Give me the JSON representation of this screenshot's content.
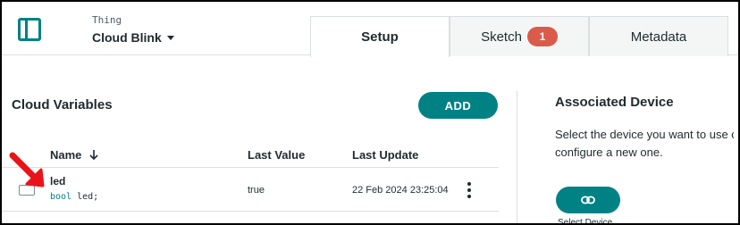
{
  "header": {
    "thing_label": "Thing",
    "thing_name": "Cloud Blink",
    "sidebar_icon": "sidebar-toggle-icon"
  },
  "tabs": [
    {
      "label": "Setup",
      "active": true
    },
    {
      "label": "Sketch",
      "badge": "1"
    },
    {
      "label": "Metadata"
    }
  ],
  "variables": {
    "title": "Cloud Variables",
    "add_label": "ADD",
    "columns": {
      "name": "Name",
      "last_value": "Last Value",
      "last_update": "Last Update"
    },
    "rows": [
      {
        "name": "led",
        "type_kw": "bool",
        "decl_rest": " led;",
        "last_value": "true",
        "last_update": "22 Feb 2024 23:25:04"
      }
    ]
  },
  "device": {
    "title": "Associated Device",
    "description_line1": "Select the device you want to use o",
    "description_line2": "configure a new one.",
    "select_label": "Select Device"
  },
  "colors": {
    "accent": "#008184",
    "badge": "#da5b4a",
    "annotation_arrow": "#e8141a"
  }
}
